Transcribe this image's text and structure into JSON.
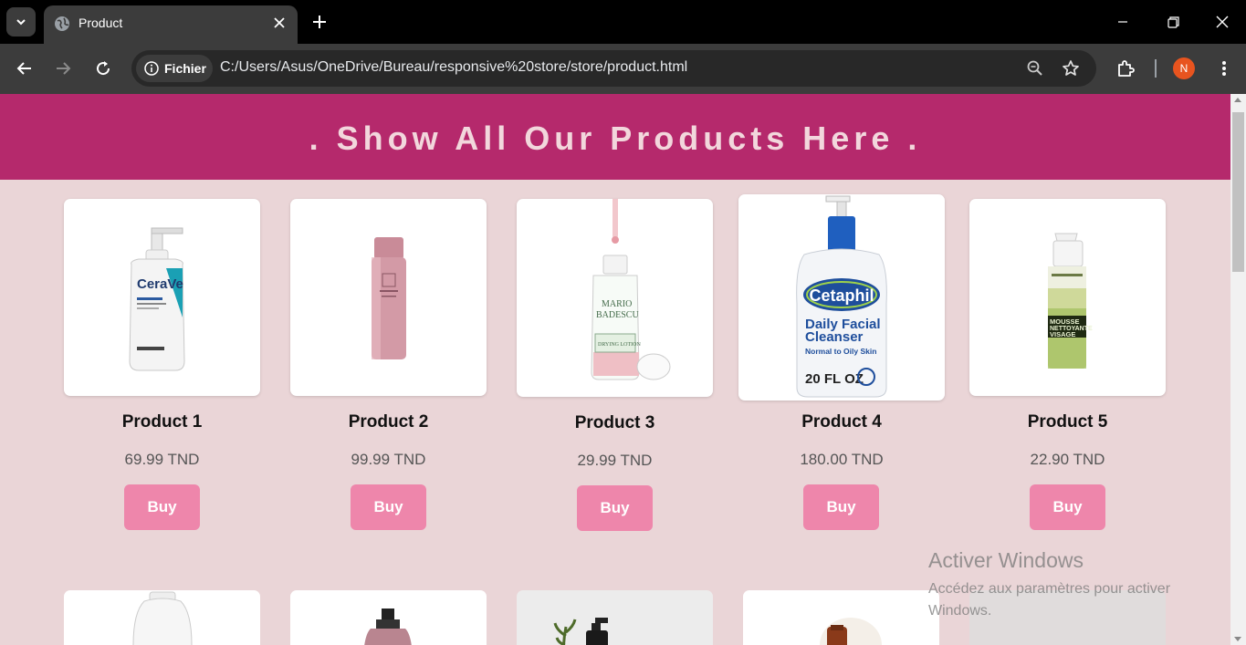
{
  "browser": {
    "tab_title": "Product",
    "security_chip": "Fichier",
    "url": "C:/Users/Asus/OneDrive/Bureau/responsive%20store/store/product.html",
    "profile_initial": "N"
  },
  "page": {
    "banner_title": ". Show All Our Products Here .",
    "colors": {
      "banner": "#b5296c",
      "background": "#ead5d7",
      "buy_button": "#ee86ab"
    },
    "products": [
      {
        "name": "Product 1",
        "price": "69.99 TND",
        "buy_label": "Buy",
        "image": "cerave-cleanser-image"
      },
      {
        "name": "Product 2",
        "price": "99.99 TND",
        "buy_label": "Buy",
        "image": "pink-bottle-image"
      },
      {
        "name": "Product 3",
        "price": "29.99 TND",
        "buy_label": "Buy",
        "image": "mario-badescu-image"
      },
      {
        "name": "Product 4",
        "price": "180.00 TND",
        "buy_label": "Buy",
        "image": "cetaphil-image"
      },
      {
        "name": "Product 5",
        "price": "22.90 TND",
        "buy_label": "Buy",
        "image": "foam-cleanser-image"
      }
    ],
    "product_4_label": {
      "brand": "Cetaphil",
      "line1": "Daily Facial",
      "line2": "Cleanser",
      "line3": "Normal to Oily Skin",
      "size": "20 FL OZ"
    },
    "product_1_label": {
      "brand": "CeraVe"
    },
    "product_3_label": {
      "brand1": "MARIO",
      "brand2": "BADESCU",
      "line": "DRYING LOTION"
    },
    "product_5_label": {
      "line1": "MOUSSE",
      "line2": "NETTOYANTE",
      "line3": "VISAGE"
    }
  },
  "os_watermark": {
    "title": "Activer Windows",
    "subtitle": "Accédez aux paramètres pour activer Windows."
  }
}
